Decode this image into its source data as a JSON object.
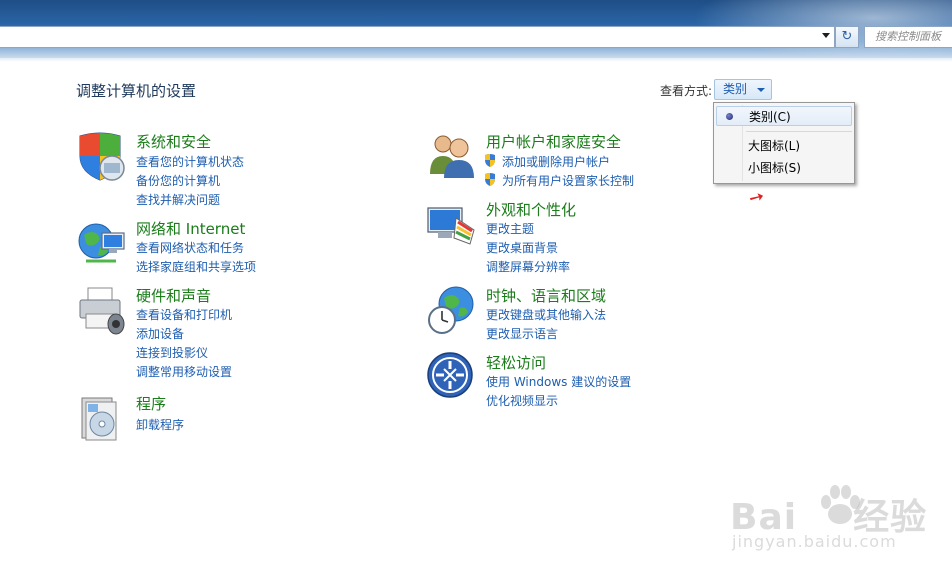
{
  "toolbar": {
    "search_placeholder": "搜索控制面板",
    "refresh_glyph": "↻"
  },
  "header": {
    "title": "调整计算机的设置",
    "view_by_label": "查看方式:",
    "view_by_value": "类别"
  },
  "view_menu": {
    "items": [
      {
        "label": "类别(C)",
        "selected": true
      },
      {
        "label": "大图标(L)",
        "selected": false
      },
      {
        "label": "小图标(S)",
        "selected": false
      }
    ]
  },
  "categories": [
    {
      "title": "系统和安全",
      "icon": "security-shield-icon",
      "links": [
        {
          "label": "查看您的计算机状态",
          "shield": false
        },
        {
          "label": "备份您的计算机",
          "shield": false
        },
        {
          "label": "查找并解决问题",
          "shield": false
        }
      ]
    },
    {
      "title": "网络和 Internet",
      "icon": "network-globe-icon",
      "links": [
        {
          "label": "查看网络状态和任务",
          "shield": false
        },
        {
          "label": "选择家庭组和共享选项",
          "shield": false
        }
      ]
    },
    {
      "title": "硬件和声音",
      "icon": "printer-icon",
      "links": [
        {
          "label": "查看设备和打印机",
          "shield": false
        },
        {
          "label": "添加设备",
          "shield": false
        },
        {
          "label": "连接到投影仪",
          "shield": false
        },
        {
          "label": "调整常用移动设置",
          "shield": false
        }
      ]
    },
    {
      "title": "程序",
      "icon": "programs-disc-icon",
      "links": [
        {
          "label": "卸载程序",
          "shield": false
        }
      ]
    },
    {
      "title": "用户帐户和家庭安全",
      "icon": "users-icon",
      "links": [
        {
          "label": "添加或删除用户帐户",
          "shield": true
        },
        {
          "label": "为所有用户设置家长控制",
          "shield": true
        }
      ]
    },
    {
      "title": "外观和个性化",
      "icon": "display-palette-icon",
      "links": [
        {
          "label": "更改主题",
          "shield": false
        },
        {
          "label": "更改桌面背景",
          "shield": false
        },
        {
          "label": "调整屏幕分辨率",
          "shield": false
        }
      ]
    },
    {
      "title": "时钟、语言和区域",
      "icon": "clock-globe-icon",
      "links": [
        {
          "label": "更改键盘或其他输入法",
          "shield": false
        },
        {
          "label": "更改显示语言",
          "shield": false
        }
      ]
    },
    {
      "title": "轻松访问",
      "icon": "ease-of-access-icon",
      "links": [
        {
          "label": "使用 Windows 建议的设置",
          "shield": false
        },
        {
          "label": "优化视频显示",
          "shield": false
        }
      ]
    }
  ],
  "watermark": {
    "brand": "Bai",
    "brand_suffix": "经验",
    "domain": "jingyan.baidu.com"
  },
  "colors": {
    "category_title": "#1a7d1a",
    "link": "#1e5eb0",
    "page_title": "#1e395b"
  }
}
